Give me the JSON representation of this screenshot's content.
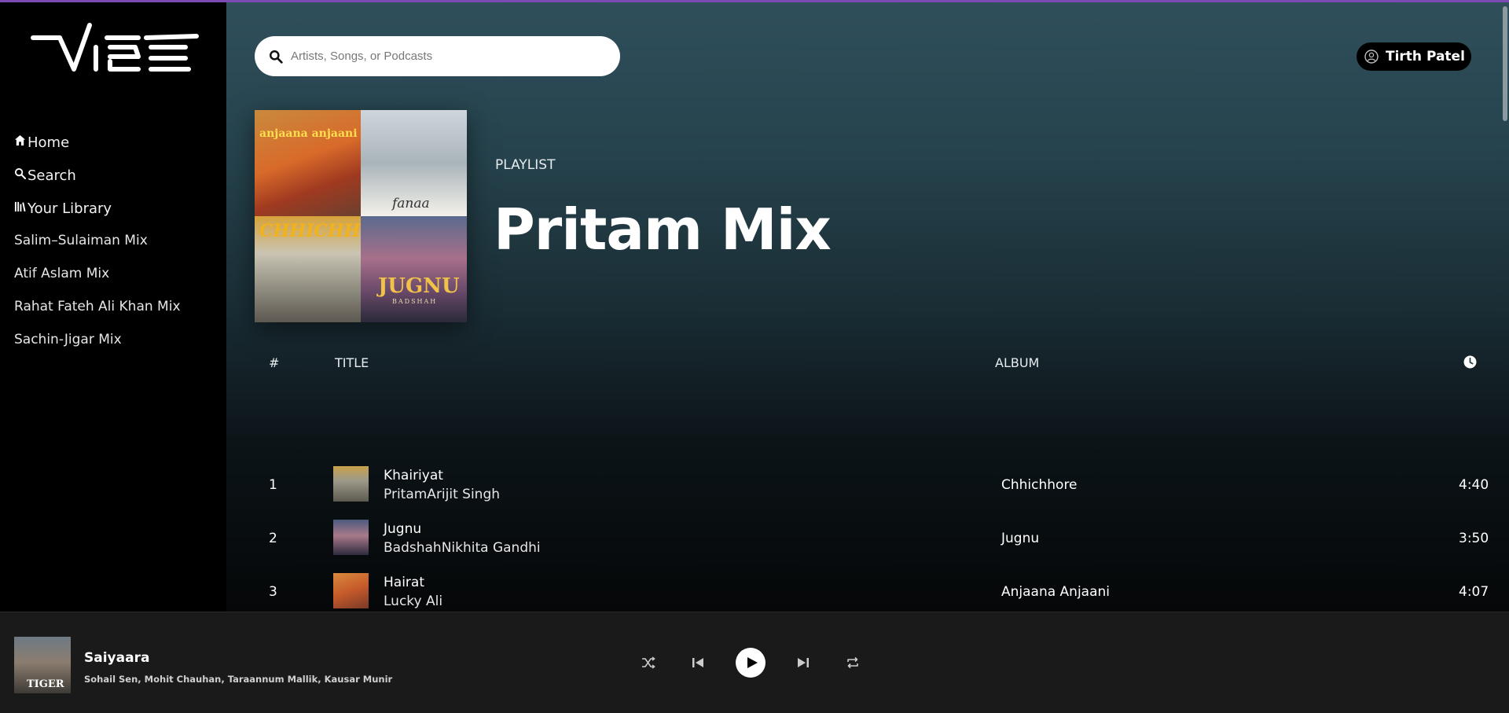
{
  "app": {
    "logo_text": "VIBE",
    "accent": "#7b4bb3"
  },
  "sidebar": {
    "nav": [
      {
        "label": "Home",
        "icon": "home-icon"
      },
      {
        "label": "Search",
        "icon": "search-icon"
      },
      {
        "label": "Your Library",
        "icon": "library-icon"
      }
    ],
    "playlists": [
      {
        "label": "Salim–Sulaiman Mix"
      },
      {
        "label": "Atif Aslam Mix"
      },
      {
        "label": "Rahat Fateh Ali Khan Mix"
      },
      {
        "label": "Sachin-Jigar Mix"
      }
    ]
  },
  "header": {
    "search_placeholder": "Artists, Songs, or Podcasts",
    "user_name": "Tirth Patel"
  },
  "playlist": {
    "type": "PLAYLIST",
    "title": "Pritam Mix",
    "covers": [
      {
        "label": "anjaana anjaani"
      },
      {
        "label": "fanaa"
      },
      {
        "label": "CHHICHHORE"
      },
      {
        "label": "JUGNU",
        "sub": "BADSHAH"
      }
    ]
  },
  "table": {
    "headers": {
      "num": "#",
      "title": "TITLE",
      "album": "ALBUM"
    },
    "rows": [
      {
        "num": "1",
        "title": "Khairiyat",
        "artists": "PritamArijit Singh",
        "album": "Chhichhore",
        "duration": "4:40"
      },
      {
        "num": "2",
        "title": "Jugnu",
        "artists": "BadshahNikhita Gandhi",
        "album": "Jugnu",
        "duration": "3:50"
      },
      {
        "num": "3",
        "title": "Hairat",
        "artists": "Lucky Ali",
        "album": "Anjaana Anjaani",
        "duration": "4:07"
      }
    ]
  },
  "player": {
    "title": "Saiyaara",
    "artists": "Sohail Sen, Mohit Chauhan, Taraannum Mallik, Kausar Munir",
    "art_label": "TIGER"
  }
}
